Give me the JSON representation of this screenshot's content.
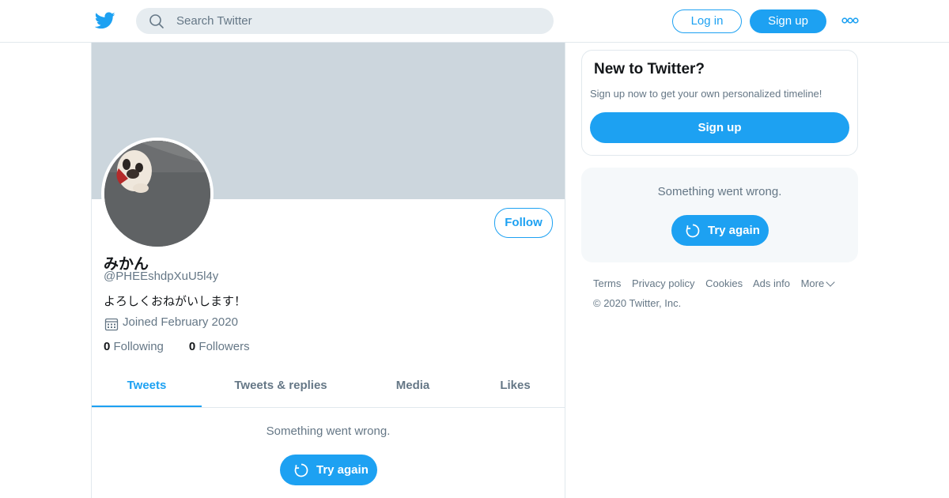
{
  "header": {
    "search_placeholder": "Search Twitter",
    "login_label": "Log in",
    "signup_label": "Sign up",
    "logo_icon": "twitter-bird-icon",
    "more_icon": "more-dots-icon"
  },
  "profile": {
    "name": "みかん",
    "handle": "@PHEEshdpXuU5l4y",
    "bio": "よろしくおねがいします！",
    "joined": "Joined February 2020",
    "following_count": "0",
    "following_label": "Following",
    "followers_count": "0",
    "followers_label": "Followers",
    "follow_label": "Follow"
  },
  "tabs": [
    {
      "label": "Tweets",
      "active": true
    },
    {
      "label": "Tweets & replies",
      "active": false
    },
    {
      "label": "Media",
      "active": false
    },
    {
      "label": "Likes",
      "active": false
    }
  ],
  "timeline": {
    "error_message": "Something went wrong.",
    "retry_label": "Try again"
  },
  "sidebar": {
    "new_title": "New to Twitter?",
    "new_subtitle": "Sign up now to get your own personalized timeline!",
    "signup_label": "Sign up",
    "error_message": "Something went wrong.",
    "retry_label": "Try again"
  },
  "footer": {
    "links": [
      "Terms",
      "Privacy policy",
      "Cookies",
      "Ads info",
      "More"
    ],
    "copyright": "© 2020 Twitter, Inc."
  },
  "colors": {
    "accent": "#1da1f2",
    "banner": "#ccd6dd",
    "muted_text": "#657786"
  }
}
